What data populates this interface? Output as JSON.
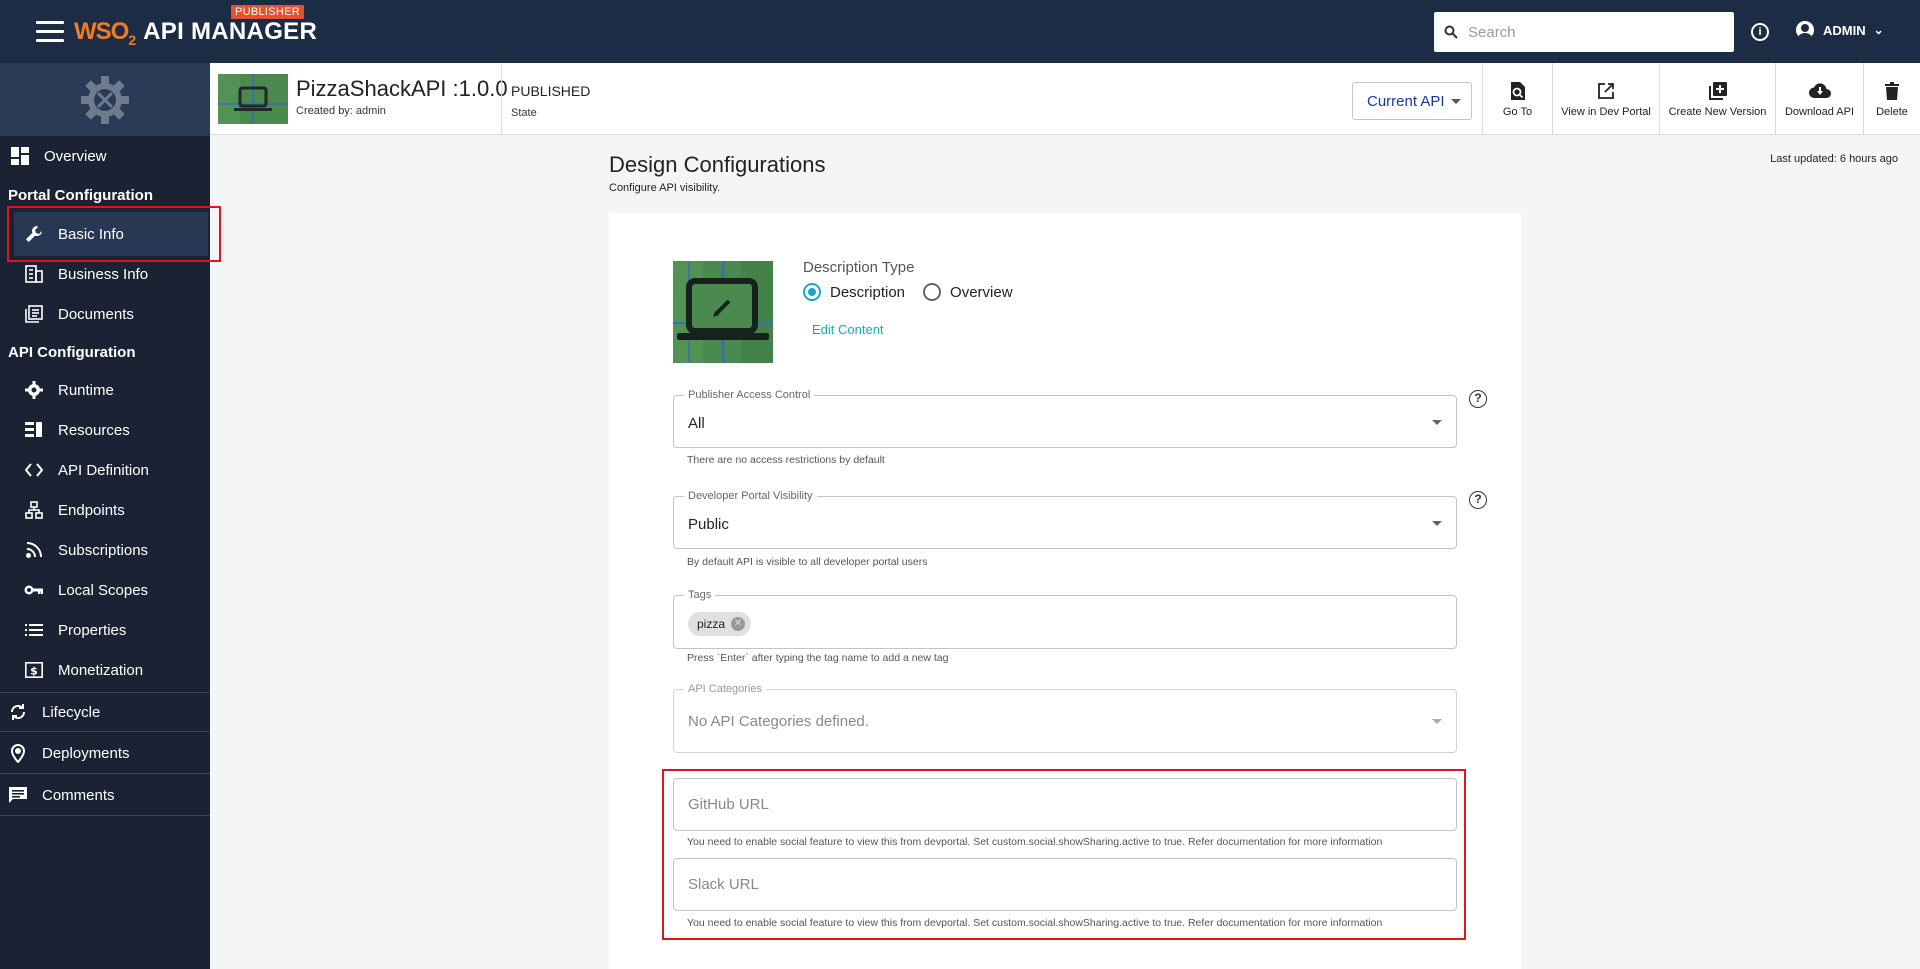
{
  "topbar": {
    "logo_brand": "WSO",
    "logo_sub": "2",
    "app_title": "API MANAGER",
    "badge": "PUBLISHER",
    "search_placeholder": "Search",
    "user": "ADMIN"
  },
  "sidebar": {
    "overview": "Overview",
    "portal_config_title": "Portal Configuration",
    "portal_items": [
      "Basic Info",
      "Business Info",
      "Documents"
    ],
    "api_config_title": "API Configuration",
    "api_items": [
      "Runtime",
      "Resources",
      "API Definition",
      "Endpoints",
      "Subscriptions",
      "Local Scopes",
      "Properties",
      "Monetization"
    ],
    "bottom_items": [
      "Lifecycle",
      "Deployments",
      "Comments"
    ]
  },
  "api_bar": {
    "name": "PizzaShackAPI :1.0.0",
    "created_by": "Created by: admin",
    "state": "PUBLISHED",
    "state_label": "State",
    "version_select": "Current API",
    "actions": [
      "Go To",
      "View in Dev Portal",
      "Create New Version",
      "Download API",
      "Delete"
    ]
  },
  "main": {
    "title": "Design Configurations",
    "subtitle": "Configure API visibility.",
    "last_updated": "Last updated: 6 hours ago",
    "description_type_label": "Description Type",
    "radio_description": "Description",
    "radio_overview": "Overview",
    "edit_content": "Edit Content",
    "access_control": {
      "label": "Publisher Access Control",
      "value": "All",
      "helper": "There are no access restrictions by default"
    },
    "visibility": {
      "label": "Developer Portal Visibility",
      "value": "Public",
      "helper": "By default API is visible to all developer portal users"
    },
    "tags": {
      "label": "Tags",
      "chips": [
        "pizza"
      ],
      "helper": "Press `Enter` after typing the tag name to add a new tag"
    },
    "categories": {
      "label": "API Categories",
      "value": "No API Categories defined."
    },
    "github": {
      "placeholder": "GitHub URL",
      "helper": "You need to enable social feature to view this from devportal. Set custom.social.showSharing.active to true. Refer documentation for more information"
    },
    "slack": {
      "placeholder": "Slack URL",
      "helper": "You need to enable social feature to view this from devportal. Set custom.social.showSharing.active to true. Refer documentation for more information"
    }
  },
  "colors": {
    "topbar": "#1d2c45",
    "sidebar": "#1a2233",
    "accent": "#1aa7c6",
    "highlight": "#e0141e",
    "badge": "#e8502c"
  }
}
